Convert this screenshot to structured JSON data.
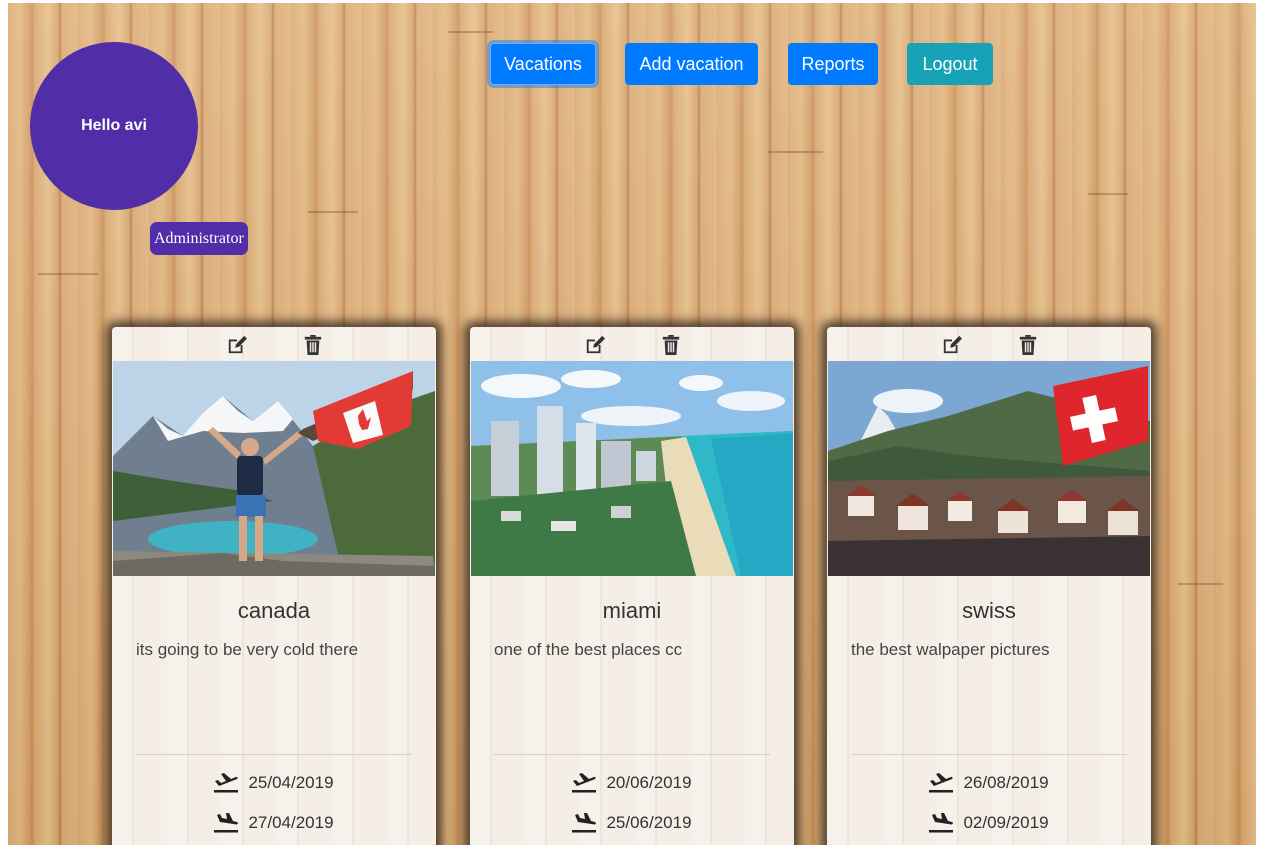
{
  "user": {
    "greeting": "Hello avi",
    "role": "Administrator"
  },
  "nav": {
    "vacations": "Vacations",
    "add_vacation": "Add vacation",
    "reports": "Reports",
    "logout": "Logout"
  },
  "colors": {
    "user_badge": "#512da8",
    "primary_button": "#007bff",
    "info_button": "#17a2b8",
    "card_background": "#f3ece4"
  },
  "icons": {
    "edit": "edit-icon",
    "delete": "trash-icon",
    "departure": "plane-departure-icon",
    "arrival": "plane-arrival-icon"
  },
  "vacations": [
    {
      "title": "canada",
      "description": "its going to be very cold there",
      "start_date": "25/04/2019",
      "end_date": "27/04/2019"
    },
    {
      "title": "miami",
      "description": "one of the best places cc",
      "start_date": "20/06/2019",
      "end_date": "25/06/2019"
    },
    {
      "title": "swiss",
      "description": "the best walpaper pictures",
      "start_date": "26/08/2019",
      "end_date": "02/09/2019"
    }
  ]
}
